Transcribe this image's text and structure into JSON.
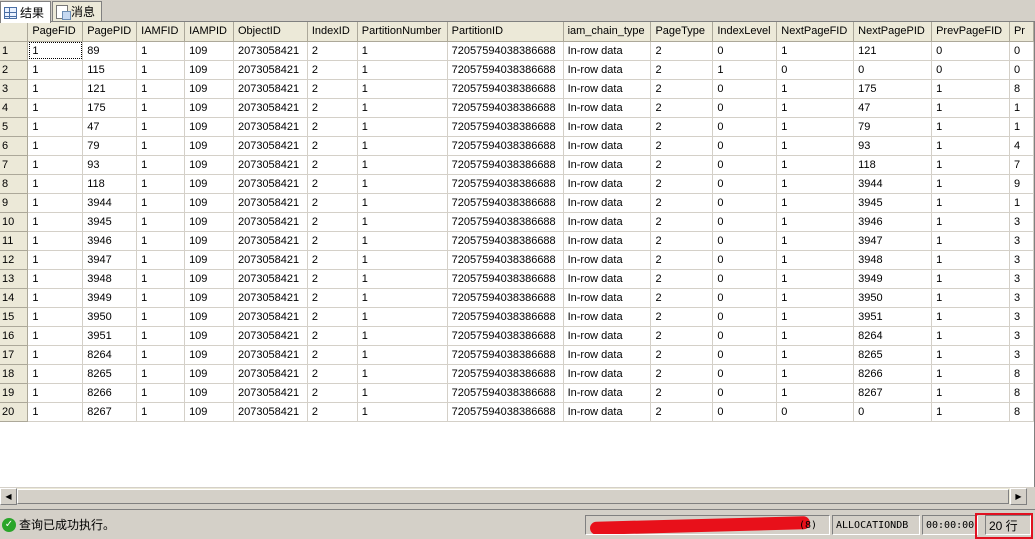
{
  "tabs": [
    {
      "label": "结果",
      "icon": "grid-icon",
      "active": true
    },
    {
      "label": "消息",
      "icon": "message-icon",
      "active": false
    }
  ],
  "grid": {
    "columns": [
      "PageFID",
      "PagePID",
      "IAMFID",
      "IAMPID",
      "ObjectID",
      "IndexID",
      "PartitionNumber",
      "PartitionID",
      "iam_chain_type",
      "PageType",
      "IndexLevel",
      "NextPageFID",
      "NextPagePID",
      "PrevPageFID",
      "Pr"
    ],
    "rows": [
      [
        "1",
        "89",
        "1",
        "109",
        "2073058421",
        "2",
        "1",
        "72057594038386688",
        "In-row data",
        "2",
        "0",
        "1",
        "121",
        "0",
        "0"
      ],
      [
        "1",
        "115",
        "1",
        "109",
        "2073058421",
        "2",
        "1",
        "72057594038386688",
        "In-row data",
        "2",
        "1",
        "0",
        "0",
        "0",
        "0"
      ],
      [
        "1",
        "121",
        "1",
        "109",
        "2073058421",
        "2",
        "1",
        "72057594038386688",
        "In-row data",
        "2",
        "0",
        "1",
        "175",
        "1",
        "8"
      ],
      [
        "1",
        "175",
        "1",
        "109",
        "2073058421",
        "2",
        "1",
        "72057594038386688",
        "In-row data",
        "2",
        "0",
        "1",
        "47",
        "1",
        "1"
      ],
      [
        "1",
        "47",
        "1",
        "109",
        "2073058421",
        "2",
        "1",
        "72057594038386688",
        "In-row data",
        "2",
        "0",
        "1",
        "79",
        "1",
        "1"
      ],
      [
        "1",
        "79",
        "1",
        "109",
        "2073058421",
        "2",
        "1",
        "72057594038386688",
        "In-row data",
        "2",
        "0",
        "1",
        "93",
        "1",
        "4"
      ],
      [
        "1",
        "93",
        "1",
        "109",
        "2073058421",
        "2",
        "1",
        "72057594038386688",
        "In-row data",
        "2",
        "0",
        "1",
        "118",
        "1",
        "7"
      ],
      [
        "1",
        "118",
        "1",
        "109",
        "2073058421",
        "2",
        "1",
        "72057594038386688",
        "In-row data",
        "2",
        "0",
        "1",
        "3944",
        "1",
        "9"
      ],
      [
        "1",
        "3944",
        "1",
        "109",
        "2073058421",
        "2",
        "1",
        "72057594038386688",
        "In-row data",
        "2",
        "0",
        "1",
        "3945",
        "1",
        "1"
      ],
      [
        "1",
        "3945",
        "1",
        "109",
        "2073058421",
        "2",
        "1",
        "72057594038386688",
        "In-row data",
        "2",
        "0",
        "1",
        "3946",
        "1",
        "3"
      ],
      [
        "1",
        "3946",
        "1",
        "109",
        "2073058421",
        "2",
        "1",
        "72057594038386688",
        "In-row data",
        "2",
        "0",
        "1",
        "3947",
        "1",
        "3"
      ],
      [
        "1",
        "3947",
        "1",
        "109",
        "2073058421",
        "2",
        "1",
        "72057594038386688",
        "In-row data",
        "2",
        "0",
        "1",
        "3948",
        "1",
        "3"
      ],
      [
        "1",
        "3948",
        "1",
        "109",
        "2073058421",
        "2",
        "1",
        "72057594038386688",
        "In-row data",
        "2",
        "0",
        "1",
        "3949",
        "1",
        "3"
      ],
      [
        "1",
        "3949",
        "1",
        "109",
        "2073058421",
        "2",
        "1",
        "72057594038386688",
        "In-row data",
        "2",
        "0",
        "1",
        "3950",
        "1",
        "3"
      ],
      [
        "1",
        "3950",
        "1",
        "109",
        "2073058421",
        "2",
        "1",
        "72057594038386688",
        "In-row data",
        "2",
        "0",
        "1",
        "3951",
        "1",
        "3"
      ],
      [
        "1",
        "3951",
        "1",
        "109",
        "2073058421",
        "2",
        "1",
        "72057594038386688",
        "In-row data",
        "2",
        "0",
        "1",
        "8264",
        "1",
        "3"
      ],
      [
        "1",
        "8264",
        "1",
        "109",
        "2073058421",
        "2",
        "1",
        "72057594038386688",
        "In-row data",
        "2",
        "0",
        "1",
        "8265",
        "1",
        "3"
      ],
      [
        "1",
        "8265",
        "1",
        "109",
        "2073058421",
        "2",
        "1",
        "72057594038386688",
        "In-row data",
        "2",
        "0",
        "1",
        "8266",
        "1",
        "8"
      ],
      [
        "1",
        "8266",
        "1",
        "109",
        "2073058421",
        "2",
        "1",
        "72057594038386688",
        "In-row data",
        "2",
        "0",
        "1",
        "8267",
        "1",
        "8"
      ],
      [
        "1",
        "8267",
        "1",
        "109",
        "2073058421",
        "2",
        "1",
        "72057594038386688",
        "In-row data",
        "2",
        "0",
        "0",
        "0",
        "1",
        "8"
      ]
    ]
  },
  "scrollbar": {
    "left_arrow": "◀",
    "right_arrow": "▶"
  },
  "status": {
    "message": "查询已成功执行。",
    "server_suffix": "(8)",
    "database": "ALLOCATIONDB",
    "elapsed": "00:00:00",
    "row_count": "20 行"
  },
  "colors": {
    "success": "#2aa52a",
    "highlight_box": "#e01020",
    "header_bg": "#ece9d8"
  }
}
